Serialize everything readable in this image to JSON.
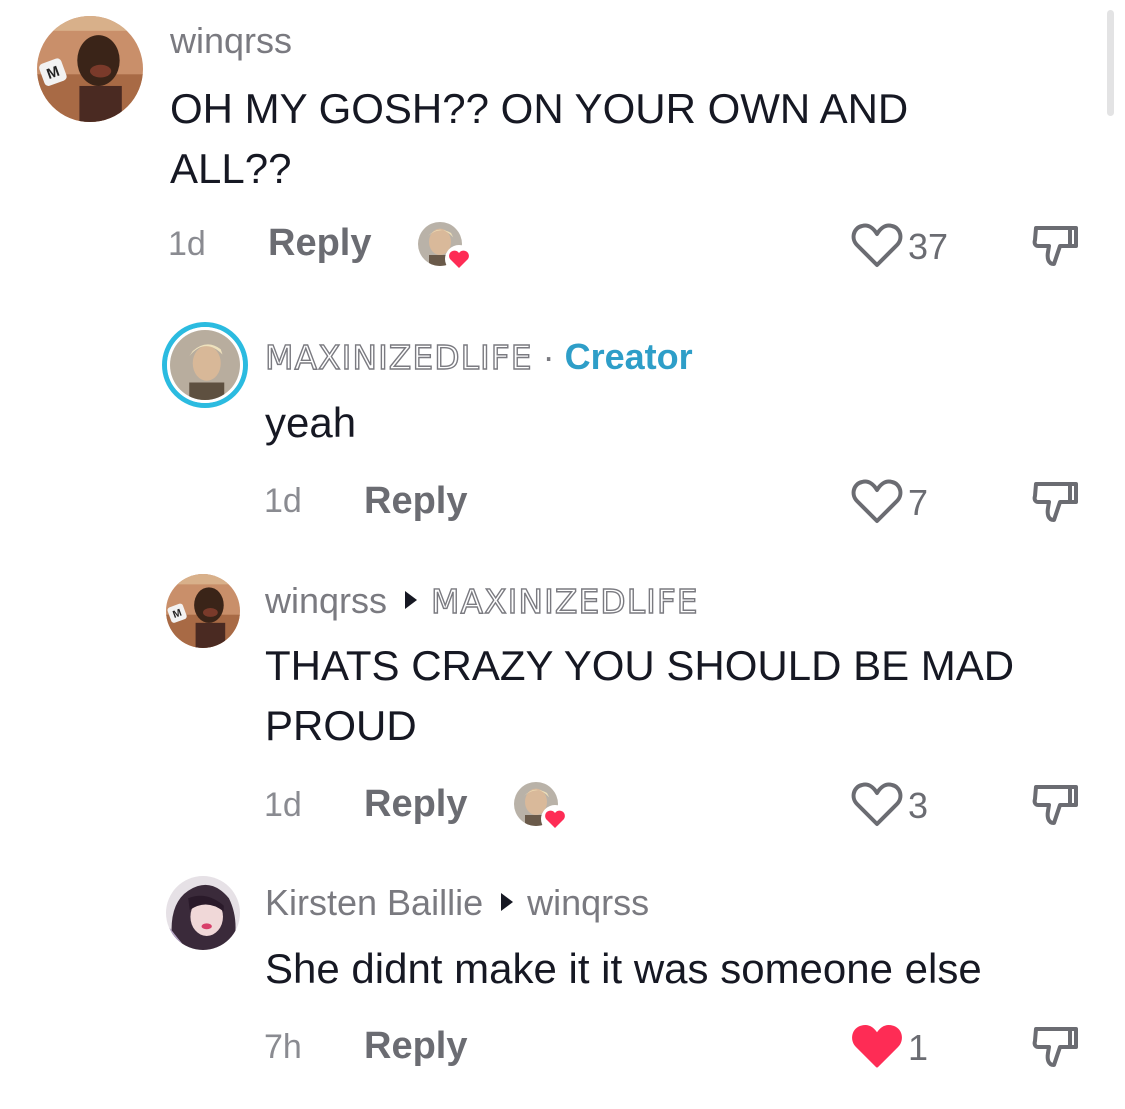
{
  "comments": [
    {
      "username": "winqrss",
      "text_line1": "OH MY GOSH?? ON YOUR OWN AND",
      "text_line2": "ALL??",
      "time": "1d",
      "reply_label": "Reply",
      "likes": "37",
      "creator_liked": true,
      "liked": false
    },
    {
      "username": "MAXINIZEDLIFE",
      "separator": "·",
      "badge": "Creator",
      "text": "yeah",
      "time": "1d",
      "reply_label": "Reply",
      "likes": "7",
      "liked": false
    },
    {
      "username": "winqrss",
      "reply_to": "MAXINIZEDLIFE",
      "text_line1": "THATS CRAZY YOU SHOULD BE MAD",
      "text_line2": "PROUD",
      "time": "1d",
      "reply_label": "Reply",
      "likes": "3",
      "creator_liked": true,
      "liked": false
    },
    {
      "username": "Kirsten Baillie",
      "reply_to": "winqrss",
      "text": "She didnt make it it was someone else",
      "time": "7h",
      "reply_label": "Reply",
      "likes": "1",
      "liked": true
    }
  ],
  "icons": {
    "like": "heart-outline-icon",
    "liked": "heart-filled-icon",
    "dislike": "thumbs-down-icon",
    "reply_arrow": "triangle-right-icon"
  },
  "colors": {
    "creator_accent": "#2e9ec8",
    "like_red": "#fe2c55",
    "muted": "#8a8b91"
  }
}
